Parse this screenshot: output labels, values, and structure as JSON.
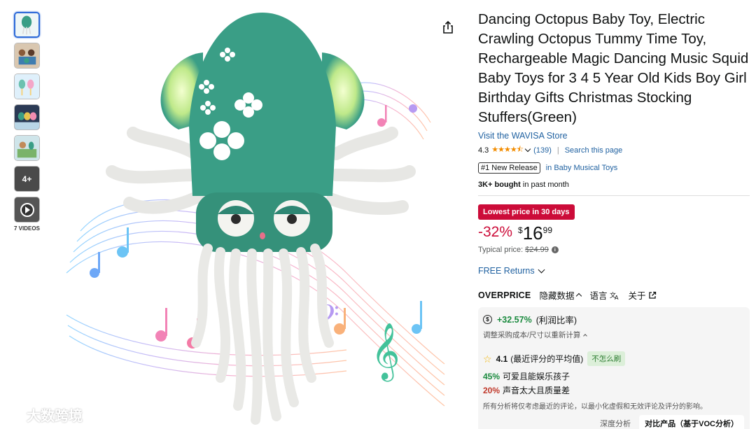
{
  "thumbnails": {
    "more_label": "4+",
    "videos_label": "7 VIDEOS"
  },
  "watermark": {
    "text": "大数跨境"
  },
  "product": {
    "title": "Dancing Octopus Baby Toy, Electric Crawling Octopus Tummy Time Toy, Rechargeable Magic Dancing Music Squid Baby Toys for 3 4 5 Year Old Kids Boy Girl Birthday Gifts Christmas Stocking Stuffers(Green)",
    "store_link": "Visit the WAVISA Store",
    "rating_value": "4.3",
    "stars": "★★★★⯪",
    "rating_count": "(139)",
    "search_page": "Search this page",
    "badge": "#1 New Release",
    "badge_category": "in Baby Musical Toys",
    "bought_bold": "3K+ bought",
    "bought_rest": " in past month",
    "deal_label": "Lowest price in 30 days",
    "discount": "-32%",
    "price_symbol": "$",
    "price_whole": "16",
    "price_fraction": "99",
    "typical_label": "Typical price:",
    "typical_price": "$24.99",
    "returns": "FREE Returns"
  },
  "overprice": {
    "brand": "OVERPRICE",
    "hide_data": "隐藏数据",
    "language": "语言",
    "about": "关于",
    "profit_pct": "+32.57%",
    "profit_label": "(利润比率)",
    "recalc": "调整采购成本/尺寸以重新计算",
    "score": "4.1",
    "score_label": "(最近评分的平均值)",
    "score_tag": "不怎么刷",
    "positive_pct": "45%",
    "positive_text": "可爱且能娱乐孩子",
    "negative_pct": "20%",
    "negative_text": "声音太大且质量差",
    "note": "所有分析将仅考虑最近的评论，以最小化虚假和无效评论及评分的影响。",
    "deep_analysis": "深度分析",
    "compare": "对比产品（基于VOC分析）"
  },
  "colors": {
    "link": "#2162A1",
    "deal": "#CC0C39",
    "toy_green": "#3a9e86",
    "positive": "#1a8a3e",
    "negative": "#c0392b"
  }
}
